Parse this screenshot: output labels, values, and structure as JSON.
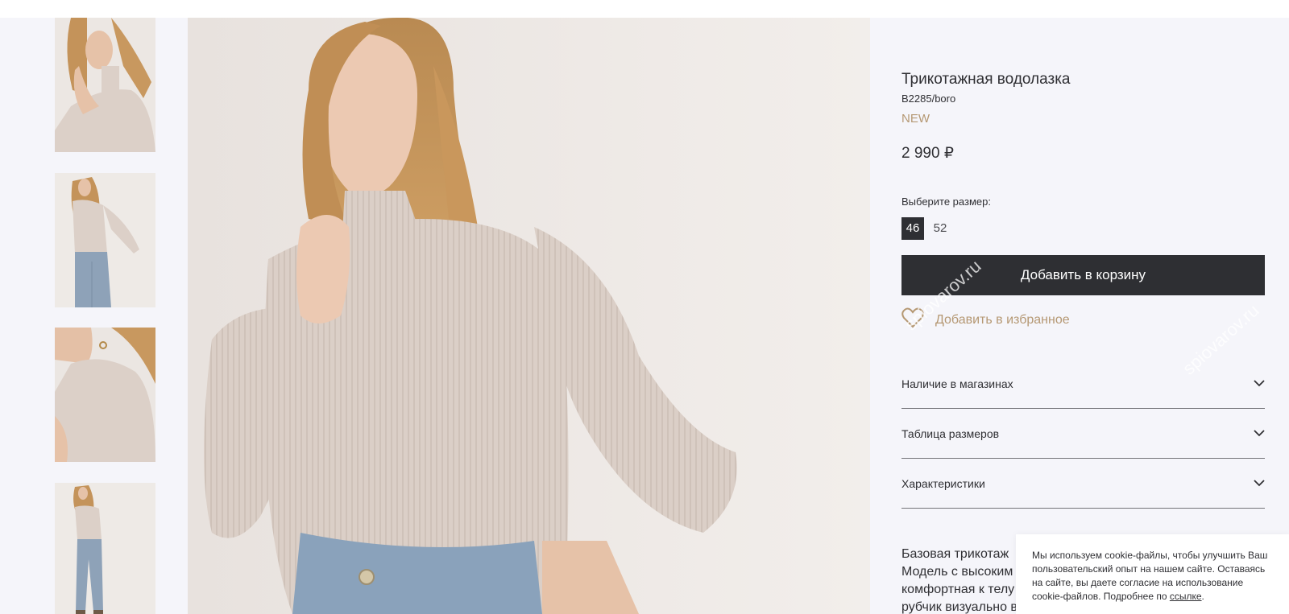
{
  "product": {
    "title": "Трикотажная водолазка",
    "sku": "B2285/boro",
    "badge": "NEW",
    "price": "2 990 ₽"
  },
  "sizes": {
    "label": "Выберите размер:",
    "options": [
      "46",
      "52"
    ],
    "selected": "46"
  },
  "actions": {
    "add_to_cart": "Добавить в корзину",
    "add_to_favorites": "Добавить в избранное"
  },
  "accordion": [
    {
      "label": "Наличие в магазинах",
      "icon": "chevron-down-icon"
    },
    {
      "label": "Таблица размеров",
      "icon": "chevron-down-icon"
    },
    {
      "label": "Характеристики",
      "icon": "chevron-down-icon"
    }
  ],
  "description": {
    "lines": [
      "Базовая трикотаж",
      "Модель с высоким",
      "комфортная к телу",
      "рубчик визуально в"
    ]
  },
  "cookie": {
    "text": "Мы используем cookie-файлы, чтобы улучшить Ваш пользовательский опыт на нашем сайте. Оставаясь на сайте, вы даете согласие на использование cookie-файлов. Подробнее по ",
    "link": "ссылке",
    "tail": "."
  },
  "watermark": "spiovarov.ru",
  "colors": {
    "accent": "#b59873",
    "button": "#2e2f33",
    "background": "#f5f5fa"
  }
}
